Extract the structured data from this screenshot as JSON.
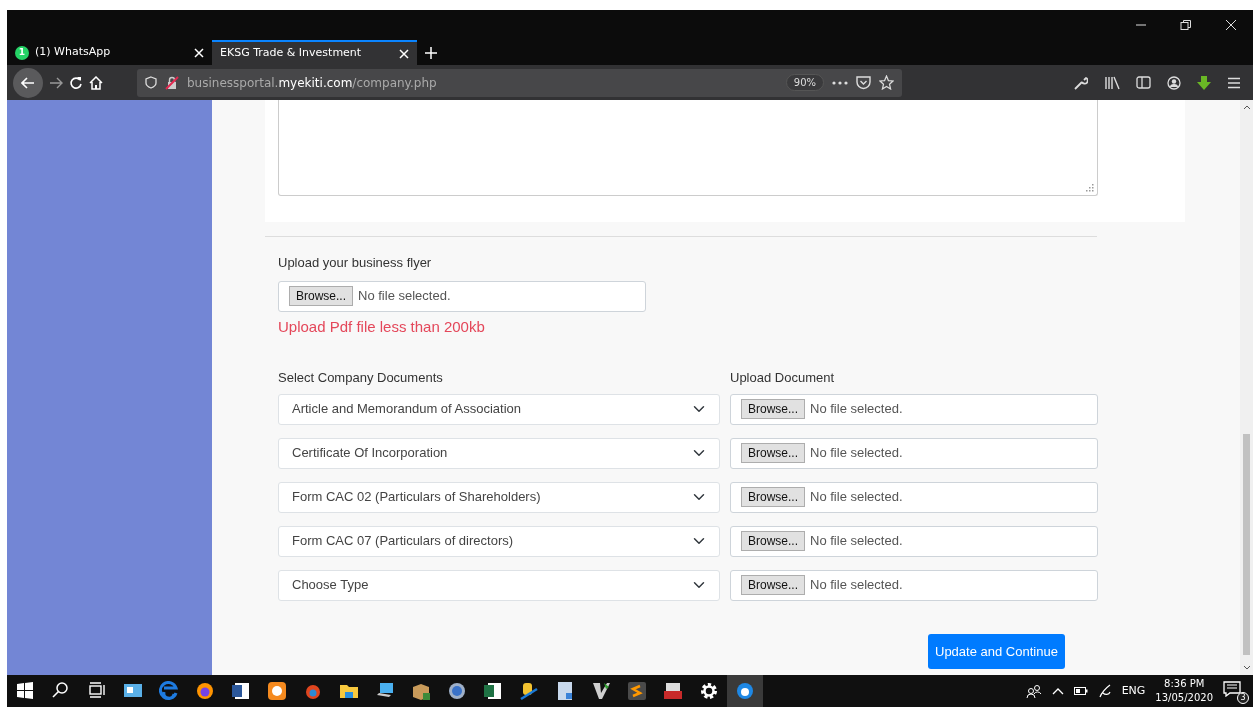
{
  "browser": {
    "tabs": [
      {
        "title": "(1) WhatsApp",
        "badge": "1",
        "selected": false
      },
      {
        "title": "EKSG Trade & Investment",
        "selected": true
      }
    ],
    "url": {
      "prefix": "businessportal.",
      "domain": "myekiti.com",
      "path": "/company.php"
    },
    "zoom": "90%"
  },
  "form": {
    "flyer": {
      "label": "Upload your business flyer",
      "button": "Browse...",
      "status": "No file selected.",
      "hint": "Upload Pdf file less than 200kb"
    },
    "documents_label": "Select Company Documents",
    "upload_label": "Upload Document",
    "documents": [
      {
        "type": "Article and Memorandum of Association",
        "button": "Browse...",
        "status": "No file selected."
      },
      {
        "type": "Certificate Of Incorporation",
        "button": "Browse...",
        "status": "No file selected."
      },
      {
        "type": "Form CAC 02 (Particulars of Shareholders)",
        "button": "Browse...",
        "status": "No file selected."
      },
      {
        "type": "Form CAC 07 (Particulars of directors)",
        "button": "Browse...",
        "status": "No file selected."
      },
      {
        "type": "Choose Type",
        "button": "Browse...",
        "status": "No file selected."
      }
    ],
    "submit": "Update and Continue"
  },
  "taskbar": {
    "language": "ENG",
    "time": "8:36 PM",
    "date": "13/05/2020",
    "notifications": "3"
  }
}
